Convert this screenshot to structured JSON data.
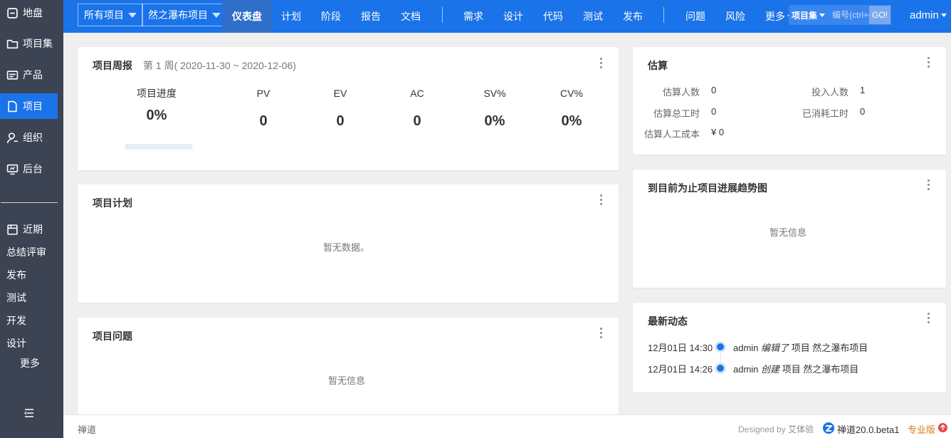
{
  "sidebar": {
    "items": [
      {
        "label": "地盘",
        "icon": "home-icon"
      },
      {
        "label": "项目集",
        "icon": "folder-icon"
      },
      {
        "label": "产品",
        "icon": "product-icon"
      },
      {
        "label": "项目",
        "icon": "file-icon"
      },
      {
        "label": "组织",
        "icon": "user-icon"
      },
      {
        "label": "后台",
        "icon": "monitor-icon"
      }
    ],
    "recent_title": "近期",
    "recent_items": [
      "总结评审",
      "发布",
      "测试",
      "开发",
      "设计"
    ],
    "more_label": "更多",
    "collapse_icon": "collapse-menu-icon"
  },
  "header": {
    "crumb_program": "所有项目",
    "crumb_project": "然之瀑布项目",
    "tabs": [
      "仪表盘",
      "计划",
      "阶段",
      "报告",
      "文档"
    ],
    "tabs2": [
      "需求",
      "设计",
      "代码",
      "测试",
      "发布"
    ],
    "tabs3": [
      "问题",
      "风险"
    ],
    "more_label": "更多",
    "search_select": "项目集",
    "search_placeholder": "编号(ctrl+g)",
    "go_label": "GO!",
    "user": "admin"
  },
  "weekly": {
    "title": "项目周报",
    "subtitle": "第 1 周( 2020-11-30 ~ 2020-12-06)",
    "progress_label": "项目进度",
    "progress_value": "0%",
    "progress_fraction": 0,
    "metrics": [
      {
        "label": "PV",
        "value": "0"
      },
      {
        "label": "EV",
        "value": "0"
      },
      {
        "label": "AC",
        "value": "0"
      },
      {
        "label": "SV%",
        "value": "0%"
      },
      {
        "label": "CV%",
        "value": "0%"
      }
    ]
  },
  "plan": {
    "title": "项目计划",
    "empty": "暂无数据。"
  },
  "issues": {
    "title": "项目问题",
    "empty": "暂无信息"
  },
  "estimate": {
    "title": "估算",
    "rows": [
      {
        "label": "估算人数",
        "value": "0"
      },
      {
        "label": "投入人数",
        "value": "1"
      },
      {
        "label": "估算总工时",
        "value": "0"
      },
      {
        "label": "已消耗工时",
        "value": "0"
      },
      {
        "label": "估算人工成本",
        "value": "¥ 0"
      }
    ]
  },
  "trend": {
    "title": "到目前为止项目进展趋势图",
    "empty": "暂无信息"
  },
  "dynamics": {
    "title": "最新动态",
    "items": [
      {
        "time": "12月01日 14:30",
        "user": "admin",
        "action": "编辑了",
        "object": "项目 然之瀑布项目"
      },
      {
        "time": "12月01日 14:26",
        "user": "admin",
        "action": "创建",
        "object": "项目 然之瀑布项目"
      }
    ]
  },
  "footer": {
    "left": "禅道",
    "designed_prefix": "Designed by",
    "designed_by": "艾体验",
    "version": "禅道20.0.beta1",
    "edition": "专业版"
  },
  "colors": {
    "brand": "#1a73e8",
    "sidebar": "#3c4353",
    "edition": "#e0761d"
  }
}
